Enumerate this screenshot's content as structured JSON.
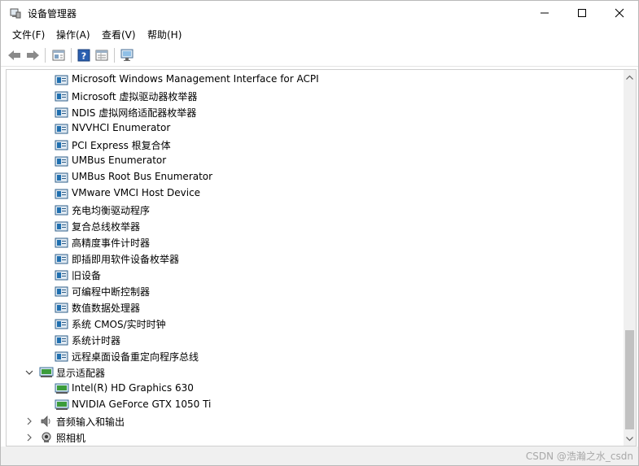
{
  "window": {
    "title": "设备管理器",
    "icon": "device-manager-icon"
  },
  "menu": [
    "文件(F)",
    "操作(A)",
    "查看(V)",
    "帮助(H)"
  ],
  "toolbar": {
    "buttons": [
      "back-arrow-icon",
      "forward-arrow-icon",
      "properties-icon",
      "help-icon",
      "details-view-icon",
      "monitor-icon"
    ]
  },
  "tree": {
    "items": [
      {
        "label": "Microsoft Windows Management Interface for ACPI",
        "level": 2,
        "icon": "system-device-icon"
      },
      {
        "label": "Microsoft 虚拟驱动器枚举器",
        "level": 2,
        "icon": "system-device-icon"
      },
      {
        "label": "NDIS 虚拟网络适配器枚举器",
        "level": 2,
        "icon": "system-device-icon"
      },
      {
        "label": "NVVHCI Enumerator",
        "level": 2,
        "icon": "system-device-icon"
      },
      {
        "label": "PCI Express 根复合体",
        "level": 2,
        "icon": "system-device-icon"
      },
      {
        "label": "UMBus Enumerator",
        "level": 2,
        "icon": "system-device-icon"
      },
      {
        "label": "UMBus Root Bus Enumerator",
        "level": 2,
        "icon": "system-device-icon"
      },
      {
        "label": "VMware VMCI Host Device",
        "level": 2,
        "icon": "system-device-icon"
      },
      {
        "label": "充电均衡驱动程序",
        "level": 2,
        "icon": "system-device-icon"
      },
      {
        "label": "复合总线枚举器",
        "level": 2,
        "icon": "system-device-icon"
      },
      {
        "label": "高精度事件计时器",
        "level": 2,
        "icon": "system-device-icon"
      },
      {
        "label": "即插即用软件设备枚举器",
        "level": 2,
        "icon": "system-device-icon"
      },
      {
        "label": "旧设备",
        "level": 2,
        "icon": "system-device-icon"
      },
      {
        "label": "可编程中断控制器",
        "level": 2,
        "icon": "system-device-icon"
      },
      {
        "label": "数值数据处理器",
        "level": 2,
        "icon": "system-device-icon"
      },
      {
        "label": "系统 CMOS/实时时钟",
        "level": 2,
        "icon": "system-device-icon"
      },
      {
        "label": "系统计时器",
        "level": 2,
        "icon": "system-device-icon"
      },
      {
        "label": "远程桌面设备重定向程序总线",
        "level": 2,
        "icon": "system-device-icon"
      },
      {
        "label": "显示适配器",
        "level": 1,
        "icon": "display-adapter-icon",
        "expanded": true
      },
      {
        "label": "Intel(R) HD Graphics 630",
        "level": 2,
        "icon": "display-adapter-icon"
      },
      {
        "label": "NVIDIA GeForce GTX 1050 Ti",
        "level": 2,
        "icon": "display-adapter-icon"
      },
      {
        "label": "音频输入和输出",
        "level": 1,
        "icon": "speaker-icon",
        "expanded": false
      },
      {
        "label": "照相机",
        "level": 1,
        "icon": "camera-icon",
        "expanded": false
      }
    ]
  },
  "statusbar": {
    "watermark": "CSDN @浩瀚之水_csdn"
  },
  "colors": {
    "accent": "#2a7ab8",
    "device_blue": "#1f6fb0",
    "monitor_green": "#3b9c3b",
    "scroll_thumb": "#c1c1c1"
  }
}
